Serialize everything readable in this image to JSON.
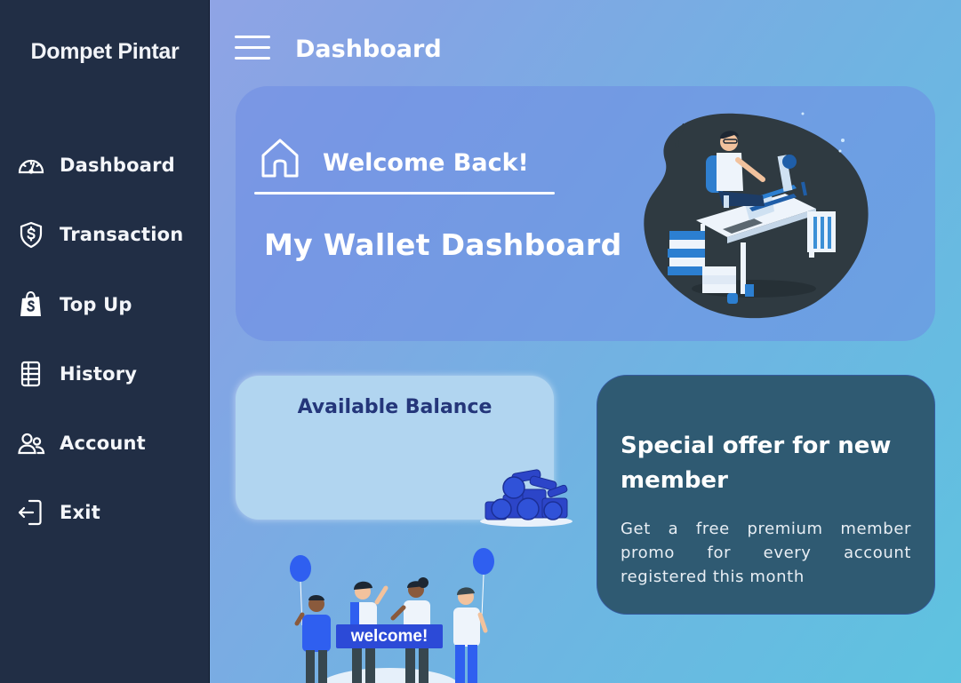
{
  "app": {
    "brand": "Dompet Pintar"
  },
  "sidebar": {
    "items": [
      {
        "label": "Dashboard",
        "icon": "speedometer-icon"
      },
      {
        "label": "Transaction",
        "icon": "shield-dollar-icon"
      },
      {
        "label": "Top Up",
        "icon": "shopping-bag-icon"
      },
      {
        "label": "History",
        "icon": "ledger-icon"
      },
      {
        "label": "Account",
        "icon": "users-icon"
      },
      {
        "label": "Exit",
        "icon": "exit-icon"
      }
    ]
  },
  "header": {
    "title": "Dashboard"
  },
  "hero": {
    "greeting": "Welcome Back!",
    "title": "My Wallet Dashboard"
  },
  "balance": {
    "title": "Available Balance"
  },
  "offer": {
    "title": "Special offer for new member",
    "text": "Get a free premium member promo for every account registered this month"
  },
  "illustration": {
    "banner": "welcome!"
  },
  "colors": {
    "sidebar": "#212e45",
    "offer_card": "#2f5a72",
    "balance_card": "#b1d5f0",
    "balance_title": "#24367a",
    "banner": "#2c4ad7"
  }
}
